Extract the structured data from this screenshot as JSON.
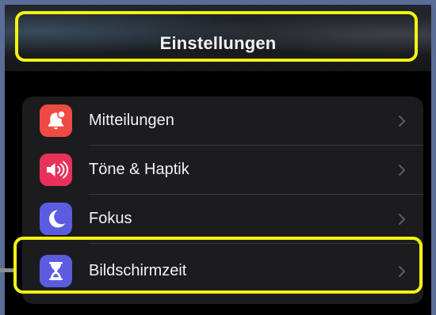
{
  "header": {
    "title": "Einstellungen"
  },
  "settings": {
    "items": [
      {
        "label": "Mitteilungen",
        "icon": "bell-badge-icon",
        "color": "#ef4a43"
      },
      {
        "label": "Töne & Haptik",
        "icon": "speaker-icon",
        "color": "#e8325a"
      },
      {
        "label": "Fokus",
        "icon": "moon-icon",
        "color": "#5c5ce0"
      },
      {
        "label": "Bildschirmzeit",
        "icon": "hourglass-icon",
        "color": "#5c5ce0"
      }
    ]
  },
  "colors": {
    "highlight": "#f4f312",
    "background": "#000000",
    "group_background": "#1c1c1e",
    "outer_background": "#5a6d96"
  }
}
